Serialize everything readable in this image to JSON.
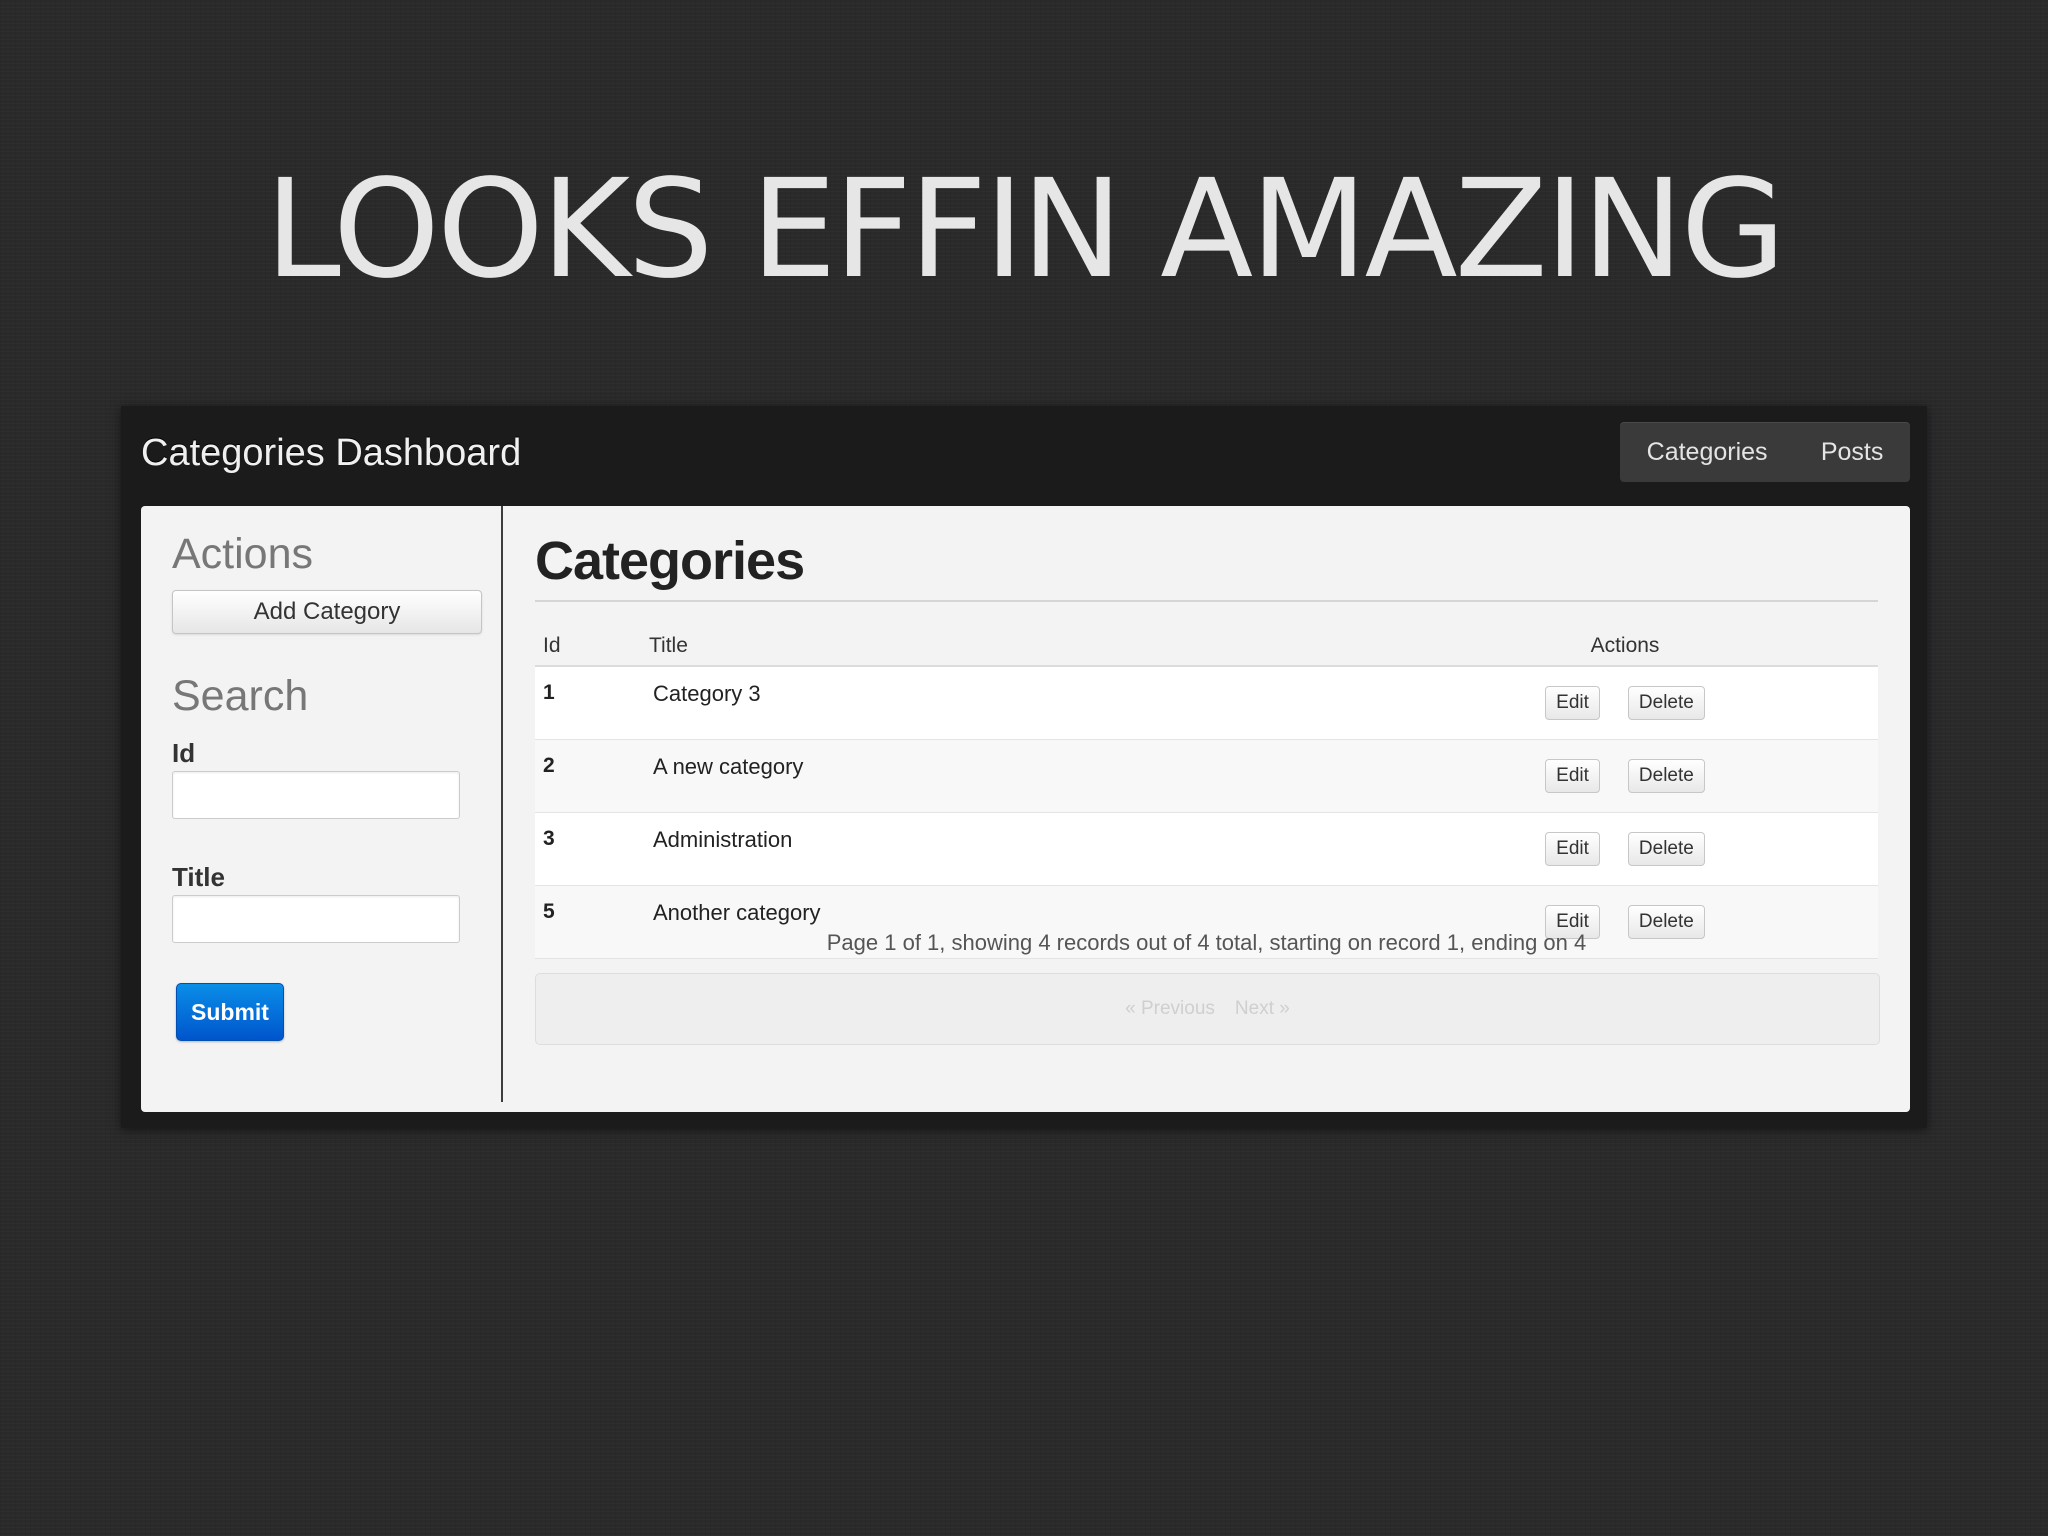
{
  "slide": {
    "title": "LOOKS EFFIN AMAZING"
  },
  "app": {
    "brand": "Categories Dashboard",
    "nav": [
      {
        "label": "Categories"
      },
      {
        "label": "Posts"
      }
    ]
  },
  "sidebar": {
    "actions_heading": "Actions",
    "add_button": "Add Category",
    "search_heading": "Search",
    "id_label": "Id",
    "id_value": "",
    "title_label": "Title",
    "title_value": "",
    "submit_label": "Submit"
  },
  "main": {
    "title": "Categories",
    "table": {
      "columns": [
        "Id",
        "Title",
        "Actions"
      ],
      "rows": [
        {
          "id": "1",
          "title": "Category 3"
        },
        {
          "id": "2",
          "title": "A new category"
        },
        {
          "id": "3",
          "title": "Administration"
        },
        {
          "id": "5",
          "title": "Another category"
        }
      ],
      "edit_label": "Edit",
      "delete_label": "Delete"
    },
    "paging_info": "Page 1 of 1, showing 4 records out of 4 total, starting on record 1, ending on 4",
    "pager": {
      "previous": "« Previous",
      "next": "Next »"
    }
  },
  "colors": {
    "slide_background": "#2a2a2b",
    "navbar": "#1b1b1b",
    "primary_button": "#0a6fdc"
  }
}
